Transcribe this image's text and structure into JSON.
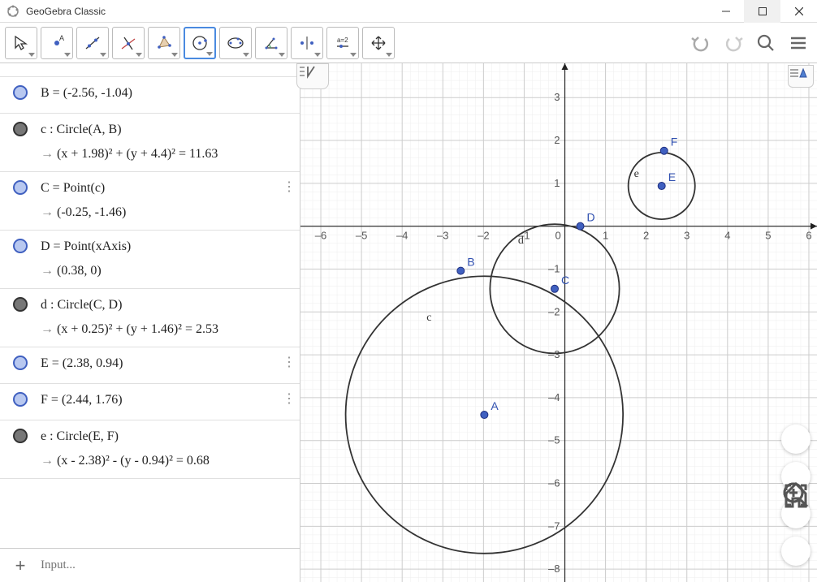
{
  "app": {
    "title": "GeoGebra Classic"
  },
  "toolbar": {
    "tools": [
      "move",
      "point",
      "line",
      "perpendicular",
      "polygon",
      "circle",
      "ellipse",
      "angle",
      "reflect",
      "slider",
      "move-view"
    ]
  },
  "algebra": {
    "items": [
      {
        "bullet": "blue",
        "line1": "A = (-1.98, -4.4)",
        "line2": "",
        "kebab": false,
        "dbl": false,
        "clip": true
      },
      {
        "bullet": "blue",
        "line1": "B = (-2.56, -1.04)",
        "line2": "",
        "kebab": false,
        "dbl": false
      },
      {
        "bullet": "gray",
        "line1": "c : Circle(A, B)",
        "line2": "→  (x + 1.98)² + (y + 4.4)² = 11.63",
        "kebab": false,
        "dbl": true
      },
      {
        "bullet": "blue",
        "line1": "C = Point(c)",
        "line2": "→  (-0.25, -1.46)",
        "kebab": true,
        "dbl": true
      },
      {
        "bullet": "blue",
        "line1": "D = Point(xAxis)",
        "line2": "→  (0.38, 0)",
        "kebab": false,
        "dbl": true
      },
      {
        "bullet": "gray",
        "line1": "d : Circle(C, D)",
        "line2": "→  (x + 0.25)² + (y + 1.46)² = 2.53",
        "kebab": false,
        "dbl": true
      },
      {
        "bullet": "blue",
        "line1": "E = (2.38, 0.94)",
        "line2": "",
        "kebab": true,
        "dbl": false
      },
      {
        "bullet": "blue",
        "line1": "F = (2.44, 1.76)",
        "line2": "",
        "kebab": true,
        "dbl": false
      },
      {
        "bullet": "gray",
        "line1": "e : Circle(E, F)",
        "line2": "→  (x - 2.38)² - (y - 0.94)² = 0.68",
        "kebab": false,
        "dbl": true
      }
    ],
    "input_placeholder": "Input..."
  },
  "chart_data": {
    "type": "scatter",
    "xlim": [
      -6.5,
      6.2
    ],
    "ylim": [
      -8.3,
      3.8
    ],
    "xticks": [
      -6,
      -5,
      -4,
      -3,
      -2,
      -1,
      0,
      1,
      2,
      3,
      4,
      5,
      6
    ],
    "yticks": [
      -8,
      -7,
      -6,
      -5,
      -4,
      -3,
      -2,
      -1,
      1,
      2,
      3
    ],
    "points": {
      "A": {
        "x": -1.98,
        "y": -4.4
      },
      "B": {
        "x": -2.56,
        "y": -1.04
      },
      "C": {
        "x": -0.25,
        "y": -1.46
      },
      "D": {
        "x": 0.38,
        "y": 0
      },
      "E": {
        "x": 2.38,
        "y": 0.94
      },
      "F": {
        "x": 2.44,
        "y": 1.76
      }
    },
    "circles": {
      "c": {
        "cx": -1.98,
        "cy": -4.4,
        "r": 3.41
      },
      "d": {
        "cx": -0.25,
        "cy": -1.46,
        "r": 1.59
      },
      "e": {
        "cx": 2.38,
        "cy": 0.94,
        "r": 0.82
      }
    },
    "circle_labels": {
      "c": {
        "x": -3.4,
        "y": -2.2,
        "text": "c"
      },
      "d": {
        "x": -1.15,
        "y": -0.4,
        "text": "d"
      },
      "e": {
        "x": 1.7,
        "y": 1.15,
        "text": "e"
      }
    }
  }
}
